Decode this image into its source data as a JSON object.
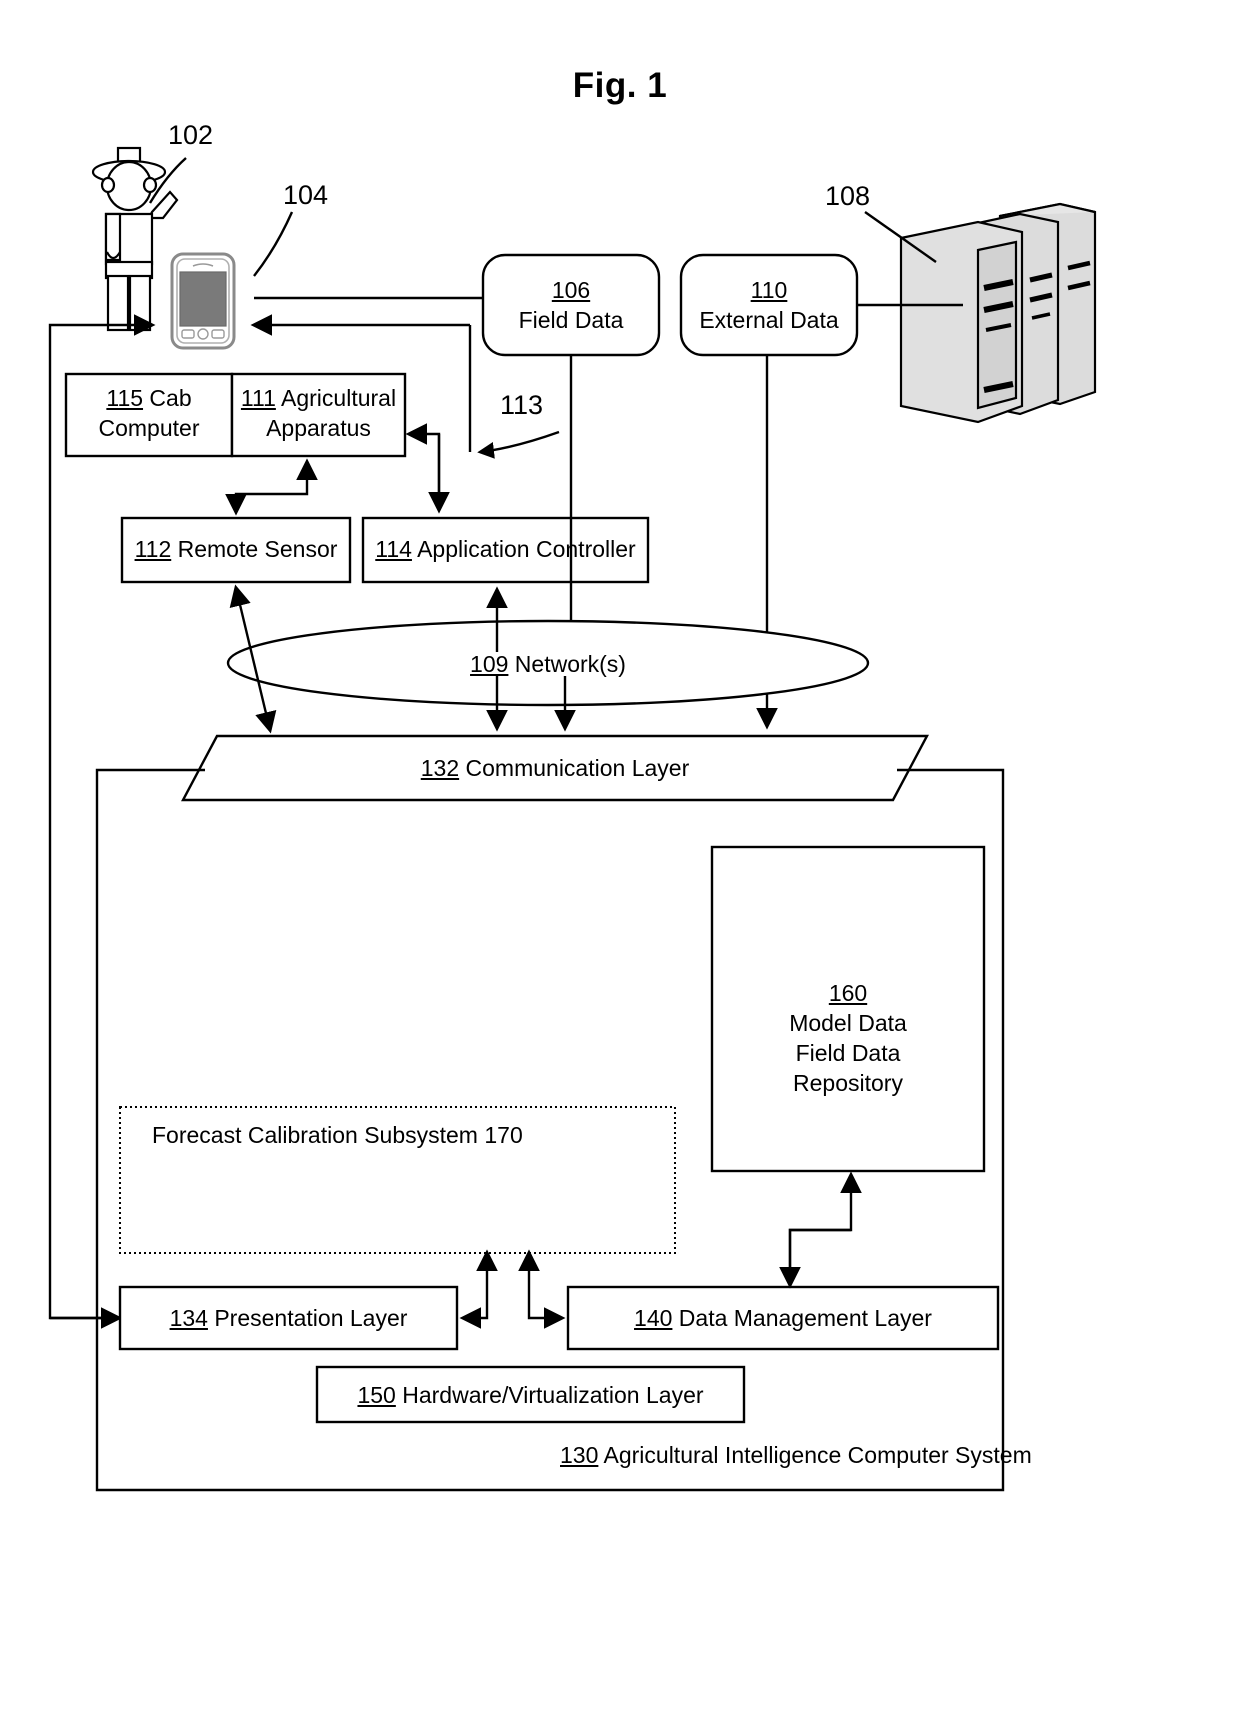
{
  "figure": {
    "title": "Fig. 1"
  },
  "callouts": {
    "grower": "102",
    "mobile_device": "104",
    "servers": "108",
    "app_controller_link": "113"
  },
  "nodes": {
    "field_data": {
      "ref": "106",
      "label": "Field Data"
    },
    "external_data": {
      "ref": "110",
      "label": "External Data"
    },
    "cab_computer": {
      "ref": "115",
      "label": "Cab",
      "label2": "Computer"
    },
    "agricultural_apparatus": {
      "ref": "111",
      "label": "Agricultural",
      "label2": "Apparatus"
    },
    "remote_sensor": {
      "ref": "112",
      "label": "Remote Sensor"
    },
    "application_controller": {
      "ref": "114",
      "label": "Application Controller"
    },
    "network": {
      "ref": "109",
      "label": "Network(s)"
    },
    "communication_layer": {
      "ref": "132",
      "label": "Communication Layer"
    },
    "repository": {
      "ref": "160",
      "line1": "Model Data",
      "line2": "Field Data",
      "line3": "Repository"
    },
    "forecast_subsystem": {
      "label": "Forecast Calibration Subsystem 170"
    },
    "presentation_layer": {
      "ref": "134",
      "label": "Presentation Layer"
    },
    "data_management_layer": {
      "ref": "140",
      "label": "Data Management Layer"
    },
    "hardware_layer": {
      "ref": "150",
      "label": "Hardware/Virtualization Layer"
    },
    "system_container": {
      "ref": "130",
      "label": "Agricultural Intelligence Computer System"
    }
  },
  "icons": {
    "grower": "person-with-hat-icon",
    "mobile_device": "mobile-phone-icon",
    "servers": "server-stack-icon"
  },
  "colors": {
    "stroke": "#000000",
    "background": "#ffffff",
    "screen_fill": "#7a7a7a"
  }
}
